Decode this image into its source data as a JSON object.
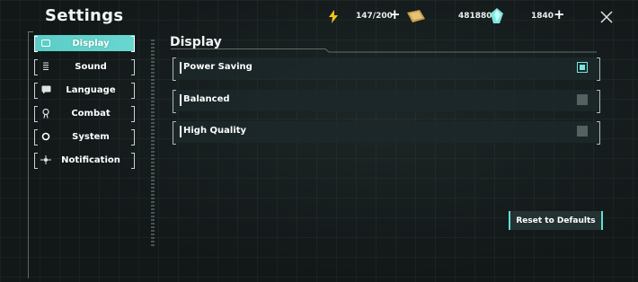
{
  "title": "Settings",
  "resources": {
    "energy": "147/200",
    "gold": "481880",
    "crystal": "1840",
    "plus": "+"
  },
  "sidebar": {
    "items": [
      {
        "label": "Display",
        "icon": "display-icon"
      },
      {
        "label": "Sound",
        "icon": "sound-icon"
      },
      {
        "label": "Language",
        "icon": "language-icon"
      },
      {
        "label": "Combat",
        "icon": "combat-icon"
      },
      {
        "label": "System",
        "icon": "system-icon"
      },
      {
        "label": "Notification",
        "icon": "notification-icon"
      }
    ],
    "active": "Display"
  },
  "section": {
    "title": "Display",
    "options": [
      {
        "label": "Power Saving",
        "selected": true
      },
      {
        "label": "Balanced",
        "selected": false
      },
      {
        "label": "High Quality",
        "selected": false
      }
    ]
  },
  "reset_label": "Reset to Defaults",
  "colors": {
    "accent": "#62ddd6",
    "background": "#131a1b",
    "energy": "#f2c318",
    "gold": "#c9a24a",
    "crystal": "#7fe6e1"
  }
}
